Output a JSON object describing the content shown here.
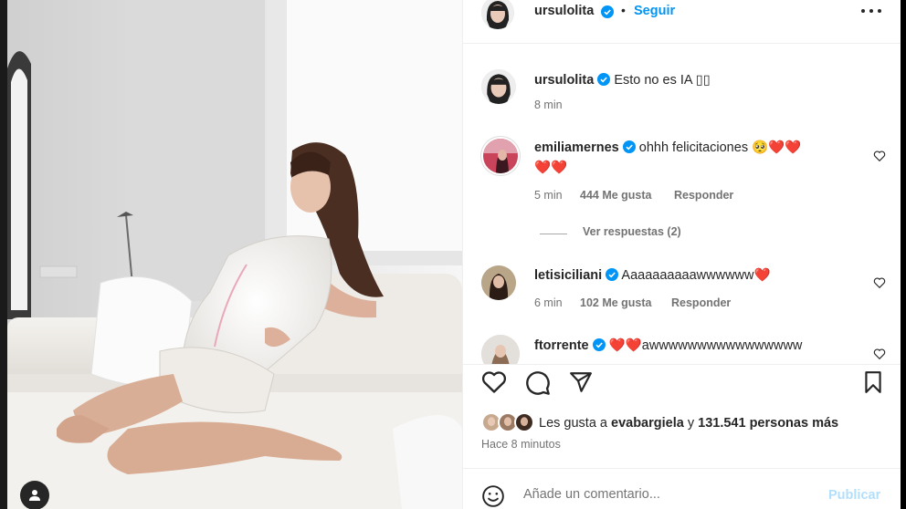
{
  "post": {
    "image_alt": "Mujer embarazada con vestido de satén blanco recostada en un sofá blanco",
    "author": "ursulolita",
    "follow_label": "Seguir",
    "separator": "•",
    "verified_icon": "verified-badge-icon",
    "more_icon": "more-options-icon"
  },
  "caption": {
    "username": "ursulolita",
    "text": "Esto no es IA ▯▯",
    "time": "8 min"
  },
  "comments": [
    {
      "username": "emiliamernes",
      "text_line1": "ohhh felicitaciones 🥺❤️❤️",
      "text_line2": "❤️❤️",
      "time": "5 min",
      "likes": "444 Me gusta",
      "reply": "Responder"
    },
    {
      "username": "letisiciliani",
      "text_line1": "Aaaaaaaaaawwwwww❤️",
      "time": "6 min",
      "likes": "102 Me gusta",
      "reply": "Responder"
    },
    {
      "username": "ftorrente",
      "text_line1": "❤️❤️awwwwwwwwwwwwwwww"
    }
  ],
  "view_replies": "Ver respuestas (2)",
  "actions": {
    "like_icon": "heart-icon",
    "comment_icon": "comment-icon",
    "share_icon": "share-icon",
    "save_icon": "bookmark-icon"
  },
  "likes": {
    "prefix": "Les gusta a ",
    "user": "evabargiela",
    "middle": " y ",
    "count": "131.541 personas más"
  },
  "time_ago": "Hace 8 minutos",
  "add_comment": {
    "placeholder": "Añade un comentario...",
    "post_label": "Publicar",
    "emoji_icon": "emoji-icon"
  },
  "colors": {
    "accent": "#0095f6",
    "heart_red": "#ed4956",
    "muted": "#737373",
    "post_disabled": "#b2dffc"
  }
}
